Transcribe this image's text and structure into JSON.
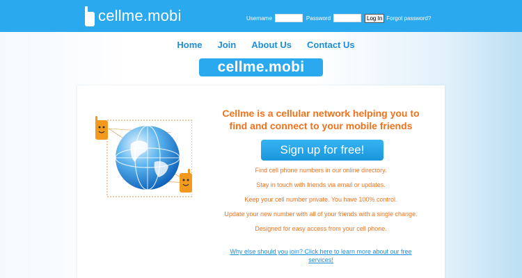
{
  "header": {
    "logo_text": "cellme.mobi",
    "login": {
      "username_label": "Username",
      "password_label": "Password",
      "username_value": "",
      "password_value": "",
      "login_button": "Log In",
      "forgot_password": "Forgot password?"
    }
  },
  "nav": {
    "items": [
      {
        "label": "Home"
      },
      {
        "label": "Join"
      },
      {
        "label": "About Us"
      },
      {
        "label": "Contact Us"
      }
    ]
  },
  "brand_banner": "cellme.mobi",
  "main": {
    "headline": "Cellme is a cellular network helping you to find and connect to your mobile friends",
    "signup_button": "Sign up for free!",
    "features": [
      "Find cell phone numbers in our online directory.",
      "Stay in touch with friends via email or updates.",
      "Keep your cell number private. You have 100% control.",
      "Update your new number with all of your friends with a single change.",
      "Designed for easy access from your cell phone."
    ],
    "why_link": "Why else should you join? Click here to learn more about our free services!"
  },
  "icons": {
    "logo": "phone-icon",
    "illustration": "globe-with-phones-icon"
  },
  "colors": {
    "topbar": "#2aa9ee",
    "nav_link": "#1c8ddb",
    "accent_orange": "#f0721c",
    "signup_button": "#1fa0e4"
  }
}
